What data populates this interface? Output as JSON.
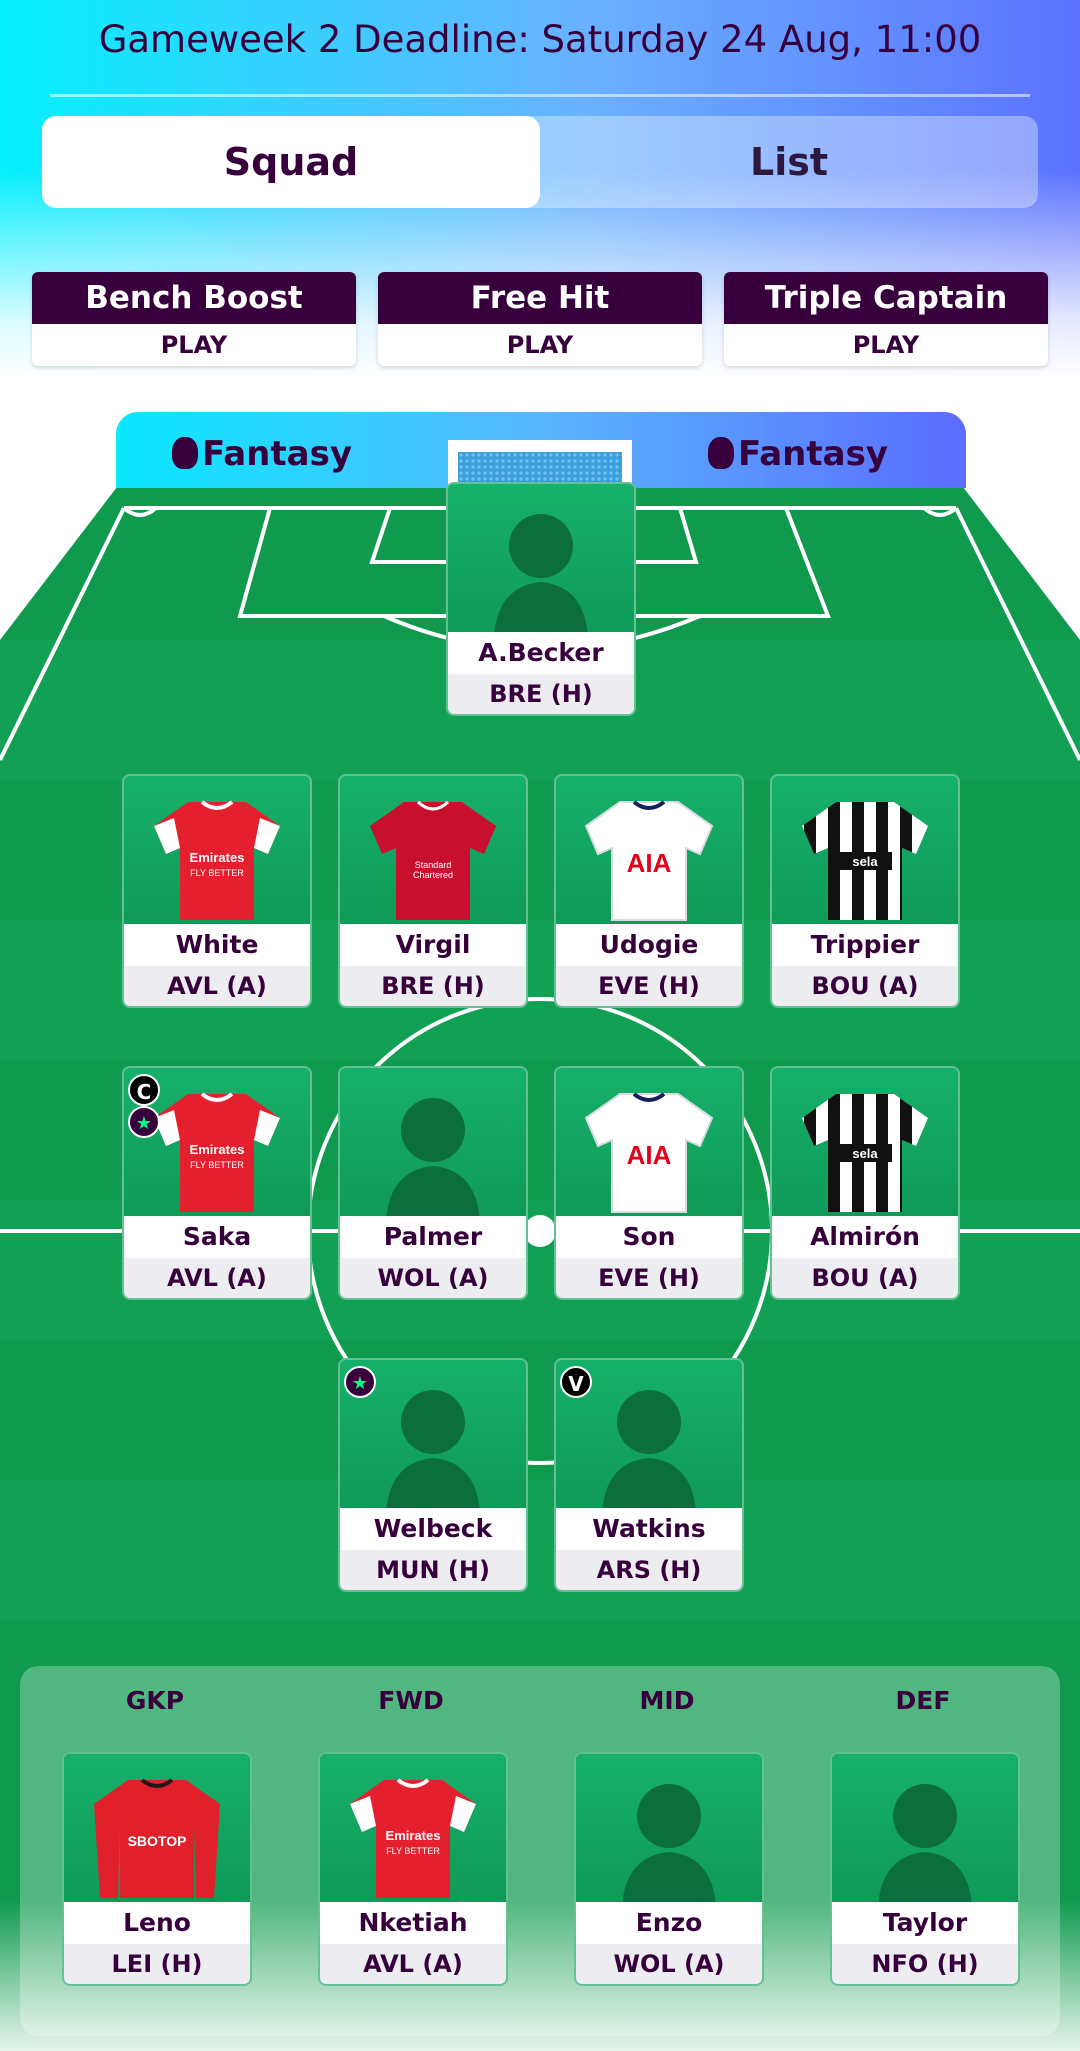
{
  "header": {
    "deadline": "Gameweek 2 Deadline: Saturday 24 Aug, 11:00",
    "toggle": {
      "squad": "Squad",
      "list": "List",
      "selected": "Squad"
    }
  },
  "chips": [
    {
      "name": "Bench Boost",
      "action": "PLAY"
    },
    {
      "name": "Free Hit",
      "action": "PLAY"
    },
    {
      "name": "Triple Captain",
      "action": "PLAY"
    }
  ],
  "pitch": {
    "brand": "Fantasy"
  },
  "goalkeeper": {
    "name": "A.Becker",
    "fixture": "BRE (H)",
    "kit": "none"
  },
  "defenders": [
    {
      "name": "White",
      "fixture": "AVL (A)",
      "kit": "arsenal"
    },
    {
      "name": "Virgil",
      "fixture": "BRE (H)",
      "kit": "liverpool"
    },
    {
      "name": "Udogie",
      "fixture": "EVE (H)",
      "kit": "tottenham"
    },
    {
      "name": "Trippier",
      "fixture": "BOU (A)",
      "kit": "newcastle"
    }
  ],
  "midfielders": [
    {
      "name": "Saka",
      "fixture": "AVL (A)",
      "kit": "arsenal",
      "captain": "C",
      "star": true
    },
    {
      "name": "Palmer",
      "fixture": "WOL (A)",
      "kit": "none"
    },
    {
      "name": "Son",
      "fixture": "EVE (H)",
      "kit": "tottenham"
    },
    {
      "name": "Almirón",
      "fixture": "BOU (A)",
      "kit": "newcastle"
    }
  ],
  "forwards": [
    {
      "name": "Welbeck",
      "fixture": "MUN (H)",
      "kit": "none",
      "star": true
    },
    {
      "name": "Watkins",
      "fixture": "ARS (H)",
      "kit": "none",
      "vice": "V"
    }
  ],
  "bench": [
    {
      "position": "GKP",
      "name": "Leno",
      "fixture": "LEI (H)",
      "kit": "fulham"
    },
    {
      "position": "FWD",
      "name": "Nketiah",
      "fixture": "AVL (A)",
      "kit": "arsenal"
    },
    {
      "position": "MID",
      "name": "Enzo",
      "fixture": "WOL (A)",
      "kit": "none"
    },
    {
      "position": "DEF",
      "name": "Taylor",
      "fixture": "NFO (H)",
      "kit": "none"
    }
  ],
  "colors": {
    "brand_purple": "#37003c",
    "pitch_green": "#12a05a",
    "star_green": "#00ff87"
  }
}
